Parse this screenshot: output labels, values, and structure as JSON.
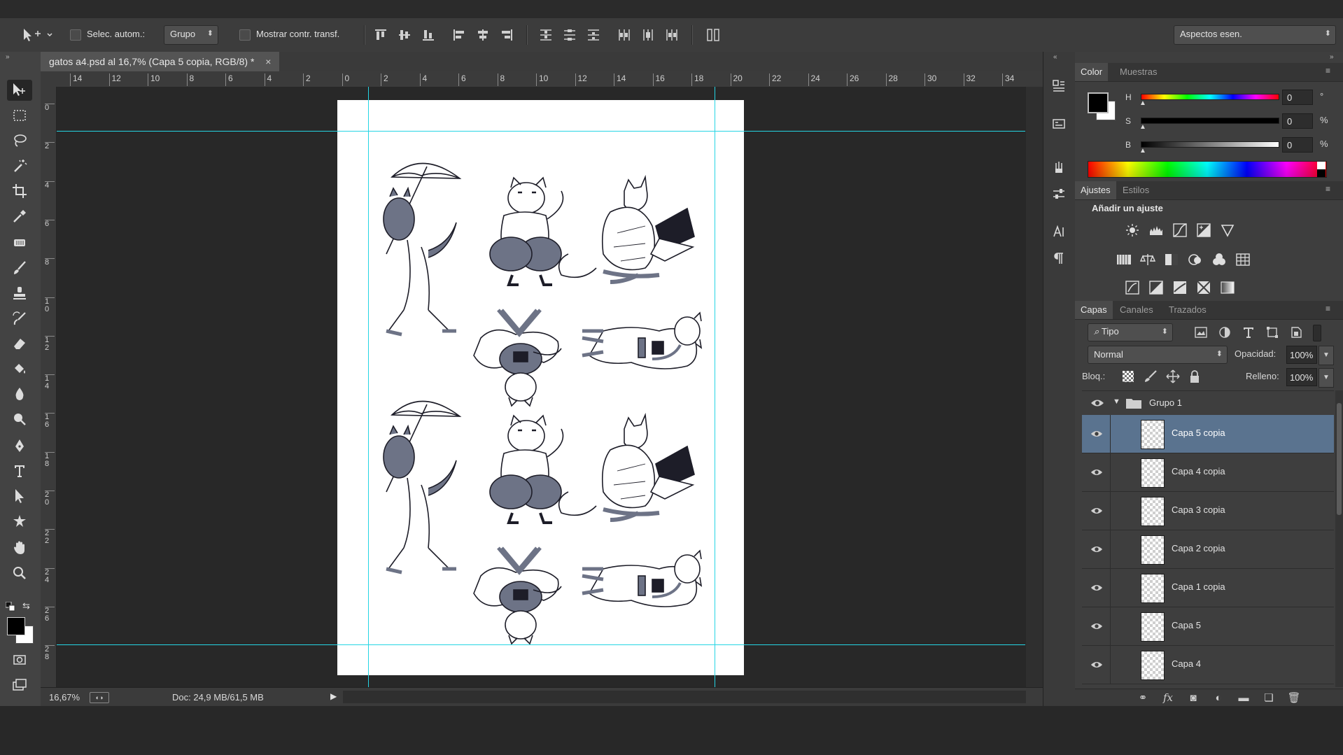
{
  "options_bar": {
    "auto_select_label": "Selec. autom.:",
    "auto_select_value": "Grupo",
    "show_transform_label": "Mostrar contr. transf.",
    "workspace_value": "Aspectos esen."
  },
  "document": {
    "tab_title": "gatos a4.psd al 16,7% (Capa 5 copia, RGB/8) *",
    "ruler_h_labels": [
      "14",
      "12",
      "10",
      "8",
      "6",
      "4",
      "2",
      "0",
      "2",
      "4",
      "6",
      "8",
      "10",
      "12",
      "14",
      "16",
      "18",
      "20",
      "22",
      "24",
      "26",
      "28",
      "30",
      "32",
      "34"
    ],
    "ruler_v_labels": [
      "0",
      "2",
      "4",
      "6",
      "8",
      "1\n0",
      "1\n2",
      "1\n4",
      "1\n6",
      "1\n8",
      "2\n0",
      "2\n2",
      "2\n4",
      "2\n6",
      "2\n8"
    ],
    "zoom": "16,67%",
    "doc_info": "Doc: 24,9 MB/61,5 MB",
    "illustration": "Cat illustration sheet (six cat poses, repeated twice)"
  },
  "color_panel": {
    "tabs": [
      "Color",
      "Muestras"
    ],
    "h_label": "H",
    "h_value": "0",
    "h_unit": "°",
    "s_label": "S",
    "s_value": "0",
    "s_unit": "%",
    "b_label": "B",
    "b_value": "0",
    "b_unit": "%",
    "foreground": "#000000",
    "background": "#ffffff"
  },
  "adjustments_panel": {
    "tabs": [
      "Ajustes",
      "Estilos"
    ],
    "heading": "Añadir un ajuste"
  },
  "layers_panel": {
    "tabs": [
      "Capas",
      "Canales",
      "Trazados"
    ],
    "filter_value": "Tipo",
    "blend_mode": "Normal",
    "opacity_label": "Opacidad:",
    "opacity_value": "100%",
    "lock_label": "Bloq.:",
    "fill_label": "Relleno:",
    "fill_value": "100%",
    "group_name": "Grupo 1",
    "layers": [
      "Capa 5 copia",
      "Capa 4 copia",
      "Capa 3 copia",
      "Capa 2 copia",
      "Capa 1 copia",
      "Capa 5",
      "Capa 4"
    ],
    "selected_index": 0
  },
  "colors": {
    "guide": "#25d5e4",
    "selected_layer": "#5a738f"
  }
}
